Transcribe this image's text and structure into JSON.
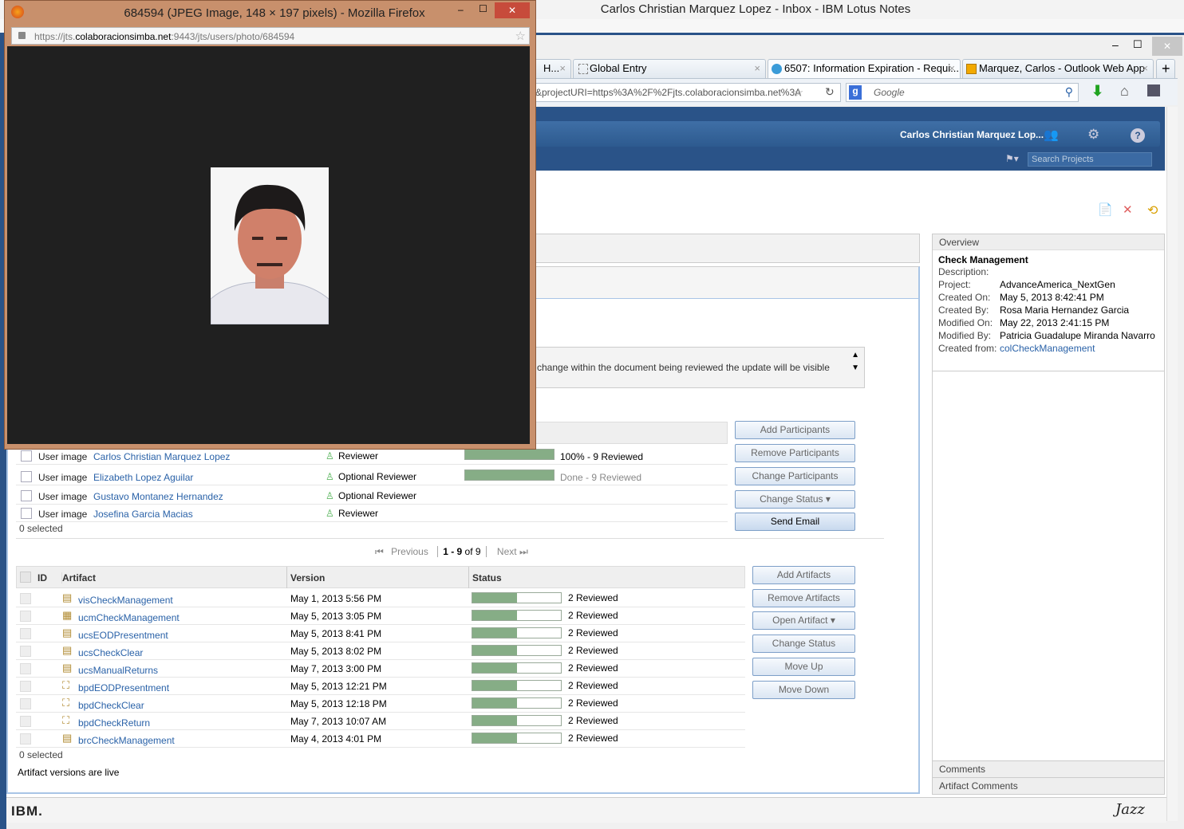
{
  "lotus": {
    "title": "Carlos Christian Marquez Lopez - Inbox - IBM Lotus Notes"
  },
  "browser": {
    "tabs": [
      {
        "label": "H...",
        "icon": "page-icon"
      },
      {
        "label": "Global Entry",
        "icon": "blank-page-icon"
      },
      {
        "label": "6507: Information Expiration - Requi...",
        "icon": "jazz-icon"
      },
      {
        "label": "Marquez, Carlos - Outlook Web App",
        "icon": "outlook-icon"
      }
    ],
    "new_tab": "+",
    "url": "&projectURI=https%3A%2F%2Fjts.colaboracionsimba.net%3A",
    "search_placeholder": "Google"
  },
  "header": {
    "user": "Carlos Christian Marquez Lop...",
    "search_placeholder": "Search Projects"
  },
  "popup": {
    "title": "684594 (JPEG Image, 148 × 197 pixels) - Mozilla Firefox",
    "url_pre": "https://jts.",
    "url_domain": "colaboracionsimba.net",
    "url_post": ":9443/jts/users/photo/684594"
  },
  "description_text": "change within the document being reviewed the update will be visible",
  "participants": {
    "rows": [
      {
        "prefix": "User image",
        "name": "Carlos Christian Marquez Lopez",
        "role": "Reviewer",
        "progress": 100,
        "status": "100% - 9 Reviewed"
      },
      {
        "prefix": "User image",
        "name": "Elizabeth Lopez Aguilar",
        "role": "Optional Reviewer",
        "progress": 100,
        "status": "Done - 9 Reviewed"
      },
      {
        "prefix": "User image",
        "name": "Gustavo Montanez Hernandez",
        "role": "Optional Reviewer",
        "progress": null,
        "status": ""
      },
      {
        "prefix": "User image",
        "name": "Josefina Garcia Macias",
        "role": "Reviewer",
        "progress": null,
        "status": ""
      }
    ],
    "selected": "0 selected",
    "buttons": [
      "Add Participants",
      "Remove Participants",
      "Change Participants",
      "Change Status",
      "Send Email"
    ]
  },
  "pager": {
    "previous": "Previous",
    "range": "1 - 9",
    "of": "of 9",
    "next": "Next"
  },
  "artifacts": {
    "headers": [
      "ID",
      "Artifact",
      "Version",
      "Status"
    ],
    "rows": [
      {
        "name": "visCheckManagement",
        "version": "May 1, 2013 5:56 PM",
        "status": "2 Reviewed",
        "icon": "document-icon",
        "progress": 50
      },
      {
        "name": "ucmCheckManagement",
        "version": "May 5, 2013 3:05 PM",
        "status": "2 Reviewed",
        "icon": "use-case-model-icon",
        "progress": 50
      },
      {
        "name": "ucsEODPresentment",
        "version": "May 5, 2013 8:41 PM",
        "status": "2 Reviewed",
        "icon": "document-icon",
        "progress": 50
      },
      {
        "name": "ucsCheckClear",
        "version": "May 5, 2013 8:02 PM",
        "status": "2 Reviewed",
        "icon": "document-icon",
        "progress": 50
      },
      {
        "name": "ucsManualReturns",
        "version": "May 7, 2013 3:00 PM",
        "status": "2 Reviewed",
        "icon": "document-icon",
        "progress": 50
      },
      {
        "name": "bpdEODPresentment",
        "version": "May 5, 2013 12:21 PM",
        "status": "2 Reviewed",
        "icon": "process-diagram-icon",
        "progress": 50
      },
      {
        "name": "bpdCheckClear",
        "version": "May 5, 2013 12:18 PM",
        "status": "2 Reviewed",
        "icon": "process-diagram-icon",
        "progress": 50
      },
      {
        "name": "bpdCheckReturn",
        "version": "May 7, 2013 10:07 AM",
        "status": "2 Reviewed",
        "icon": "process-diagram-icon",
        "progress": 50
      },
      {
        "name": "brcCheckManagement",
        "version": "May 4, 2013 4:01 PM",
        "status": "2 Reviewed",
        "icon": "document-icon",
        "progress": 50
      }
    ],
    "selected": "0 selected",
    "live_note": "Artifact versions are live",
    "buttons": [
      "Add Artifacts",
      "Remove Artifacts",
      "Open Artifact",
      "Change Status",
      "Move Up",
      "Move Down"
    ]
  },
  "overview": {
    "title": "Overview",
    "name": "Check Management",
    "fields": [
      {
        "label": "Description:",
        "value": ""
      },
      {
        "label": "Project:",
        "value": "AdvanceAmerica_NextGen"
      },
      {
        "label": "Created On:",
        "value": "May 5, 2013 8:42:41 PM"
      },
      {
        "label": "Created By:",
        "value": "Rosa Maria Hernandez Garcia"
      },
      {
        "label": "Modified On:",
        "value": "May 22, 2013 2:41:15 PM"
      },
      {
        "label": "Modified By:",
        "value": "Patricia Guadalupe Miranda Navarro"
      }
    ],
    "created_from_label": "Created from:",
    "created_from": "colCheckManagement",
    "comments": "Comments",
    "artifact_comments": "Artifact Comments"
  },
  "footer": {
    "ibm": "IBM.",
    "jazz": "Jazz"
  },
  "colors": {
    "header_blue": "#2a5388",
    "progress_green": "#86ad86",
    "link": "#2a62a8",
    "popup_border": "#c8906c"
  }
}
